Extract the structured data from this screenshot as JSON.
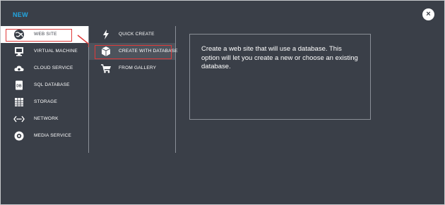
{
  "dialog": {
    "title": "NEW",
    "close_label": "×"
  },
  "nav": {
    "items": [
      {
        "label": "WEB SITE",
        "icon": "globe-icon",
        "active": true
      },
      {
        "label": "VIRTUAL MACHINE",
        "icon": "monitor-icon",
        "active": false
      },
      {
        "label": "CLOUD SERVICE",
        "icon": "cloud-gear-icon",
        "active": false
      },
      {
        "label": "SQL DATABASE",
        "icon": "database-icon",
        "active": false
      },
      {
        "label": "STORAGE",
        "icon": "storage-icon",
        "active": false
      },
      {
        "label": "NETWORK",
        "icon": "network-icon",
        "active": false
      },
      {
        "label": "MEDIA SERVICE",
        "icon": "media-gear-icon",
        "active": false
      }
    ]
  },
  "options": {
    "items": [
      {
        "label": "QUICK CREATE",
        "icon": "lightning-icon",
        "selected": false
      },
      {
        "label": "CREATE WITH DATABASE",
        "icon": "package-icon",
        "selected": true
      },
      {
        "label": "FROM GALLERY",
        "icon": "cart-icon",
        "selected": false
      }
    ]
  },
  "description": {
    "text": "Create a web site that will use a database. This option will let you create a new or choose an existing database."
  },
  "colors": {
    "background": "#3a3f48",
    "accent": "#23a6e0",
    "annotation": "#e03a3a"
  }
}
